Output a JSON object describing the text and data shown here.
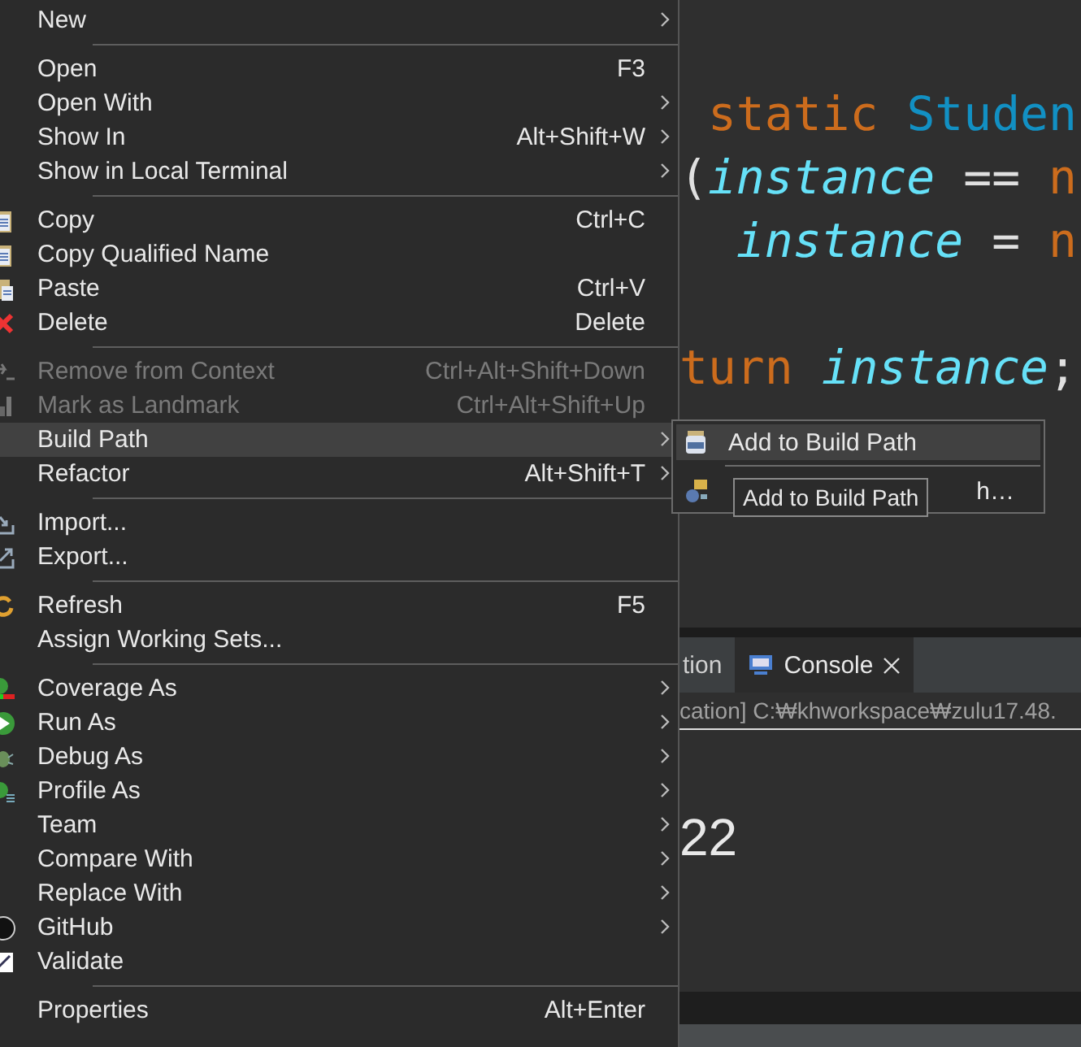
{
  "editor": {
    "lines": [
      {
        "tokens": [
          {
            "text": " static ",
            "kind": "keyword"
          },
          {
            "text": "Studen",
            "kind": "type"
          }
        ]
      },
      {
        "tokens": [
          {
            "text": "(",
            "kind": "plain"
          },
          {
            "text": "instance",
            "kind": "field"
          },
          {
            "text": " == ",
            "kind": "plain"
          },
          {
            "text": "n",
            "kind": "keyword"
          }
        ]
      },
      {
        "tokens": [
          {
            "text": "  instance",
            "kind": "field"
          },
          {
            "text": " = ",
            "kind": "plain"
          },
          {
            "text": "n",
            "kind": "keyword"
          }
        ]
      },
      {
        "tokens": [
          {
            "text": "turn ",
            "kind": "keyword"
          },
          {
            "text": "instance",
            "kind": "field"
          },
          {
            "text": ";",
            "kind": "plain"
          }
        ]
      }
    ]
  },
  "console": {
    "tabs": [
      {
        "label": "tion",
        "selected": false,
        "closable": false
      },
      {
        "label": "Console",
        "selected": true,
        "closable": true
      }
    ],
    "path": "cation] C:₩khworkspace₩zulu17.48.",
    "output": "22"
  },
  "menu": {
    "groups": [
      [
        {
          "label": "New",
          "submenu": true,
          "selected": false,
          "disabled": false
        }
      ],
      [
        {
          "label": "Open",
          "shortcut": "F3",
          "submenu": false,
          "selected": false,
          "disabled": false
        },
        {
          "label": "Open With",
          "submenu": true,
          "selected": false,
          "disabled": false
        },
        {
          "label": "Show In",
          "shortcut": "Alt+Shift+W",
          "submenu": true,
          "selected": false,
          "disabled": false
        },
        {
          "label": "Show in Local Terminal",
          "submenu": true,
          "selected": false,
          "disabled": false
        }
      ],
      [
        {
          "label": "Copy",
          "shortcut": "Ctrl+C",
          "submenu": false,
          "selected": false,
          "disabled": false
        },
        {
          "label": "Copy Qualified Name",
          "submenu": false,
          "selected": false,
          "disabled": false
        },
        {
          "label": "Paste",
          "shortcut": "Ctrl+V",
          "submenu": false,
          "selected": false,
          "disabled": false
        },
        {
          "label": "Delete",
          "shortcut": "Delete",
          "submenu": false,
          "selected": false,
          "disabled": false
        }
      ],
      [
        {
          "label": "Remove from Context",
          "shortcut": "Ctrl+Alt+Shift+Down",
          "submenu": false,
          "selected": false,
          "disabled": true
        },
        {
          "label": "Mark as Landmark",
          "shortcut": "Ctrl+Alt+Shift+Up",
          "submenu": false,
          "selected": false,
          "disabled": true
        },
        {
          "label": "Build Path",
          "submenu": true,
          "selected": true,
          "disabled": false
        },
        {
          "label": "Refactor",
          "shortcut": "Alt+Shift+T",
          "submenu": true,
          "selected": false,
          "disabled": false
        }
      ],
      [
        {
          "label": "Import...",
          "submenu": false,
          "selected": false,
          "disabled": false
        },
        {
          "label": "Export...",
          "submenu": false,
          "selected": false,
          "disabled": false
        }
      ],
      [
        {
          "label": "Refresh",
          "shortcut": "F5",
          "submenu": false,
          "selected": false,
          "disabled": false
        },
        {
          "label": "Assign Working Sets...",
          "submenu": false,
          "selected": false,
          "disabled": false
        }
      ],
      [
        {
          "label": "Coverage As",
          "submenu": true,
          "selected": false,
          "disabled": false
        },
        {
          "label": "Run As",
          "submenu": true,
          "selected": false,
          "disabled": false
        },
        {
          "label": "Debug As",
          "submenu": true,
          "selected": false,
          "disabled": false
        },
        {
          "label": "Profile As",
          "submenu": true,
          "selected": false,
          "disabled": false
        },
        {
          "label": "Team",
          "submenu": true,
          "selected": false,
          "disabled": false
        },
        {
          "label": "Compare With",
          "submenu": true,
          "selected": false,
          "disabled": false
        },
        {
          "label": "Replace With",
          "submenu": true,
          "selected": false,
          "disabled": false
        },
        {
          "label": "GitHub",
          "submenu": true,
          "selected": false,
          "disabled": false
        },
        {
          "label": "Validate",
          "submenu": false,
          "selected": false,
          "disabled": false
        }
      ],
      [
        {
          "label": "Properties",
          "shortcut": "Alt+Enter",
          "submenu": false,
          "selected": false,
          "disabled": false
        }
      ]
    ]
  },
  "submenu": {
    "items": [
      {
        "label": "Add to Build Path",
        "selected": true
      },
      {
        "label": "h…",
        "selected": false
      }
    ]
  },
  "tooltip": {
    "text": "Add to Build Path"
  }
}
